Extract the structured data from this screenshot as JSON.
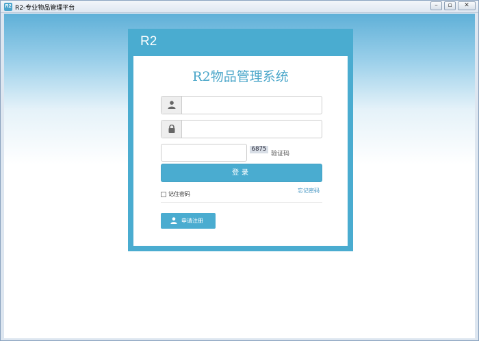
{
  "window": {
    "title": "R2-专业物品管理平台",
    "icon_text": "R2",
    "controls": {
      "minimize": "–",
      "maximize": "▫",
      "close": "✕"
    }
  },
  "panel": {
    "header": "R2",
    "system_title": "R2物品管理系统"
  },
  "form": {
    "username": {
      "value": "",
      "icon": "user-icon"
    },
    "password": {
      "value": "",
      "icon": "lock-icon"
    },
    "captcha": {
      "value": "",
      "image_text": "6875",
      "label": "验证码"
    },
    "login_label": "登录",
    "remember_label": "记住密码",
    "forgot_label": "忘记密码",
    "register_label": "申请注册"
  },
  "colors": {
    "accent": "#4aacd0",
    "title": "#4aa6c9",
    "link": "#3a8fbf"
  }
}
